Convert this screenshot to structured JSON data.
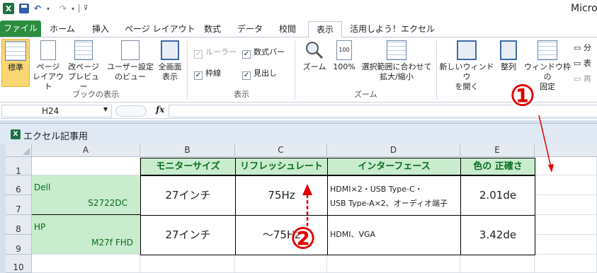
{
  "title_bar": {
    "app_title": "Micro"
  },
  "quick_access": {
    "logo": "X"
  },
  "tabs": [
    {
      "label": "ファイル"
    },
    {
      "label": "ホーム"
    },
    {
      "label": "挿入"
    },
    {
      "label": "ページ レイアウト"
    },
    {
      "label": "数式"
    },
    {
      "label": "データ"
    },
    {
      "label": "校閲"
    },
    {
      "label": "表示"
    },
    {
      "label": "活用しよう！エクセル"
    }
  ],
  "ribbon": {
    "groups": {
      "book_view": "ブックの表示",
      "show": "表示",
      "zoom": "ズーム"
    },
    "book_view": {
      "normal": "標準",
      "page_layout_1": "ページ",
      "page_layout_2": "レイアウト",
      "page_break_1": "改ページ",
      "page_break_2": "プレビュー",
      "custom_1": "ユーザー設定",
      "custom_2": "のビュー",
      "full_1": "全画面",
      "full_2": "表示"
    },
    "show": {
      "ruler": "ルーラー",
      "formula_bar": "数式バー",
      "gridlines": "枠線",
      "headings": "見出し"
    },
    "zoom": {
      "zoom": "ズーム",
      "hundred": "100%",
      "to_selection_1": "選択範囲に合わせて",
      "to_selection_2": "拡大/縮小"
    },
    "window": {
      "new_window_1": "新しいウィンドウ",
      "new_window_2": "を開く",
      "arrange": "整列",
      "freeze_1": "ウィンドウ枠の",
      "freeze_2": "固定",
      "split": "分",
      "hide": "表",
      "unhide": "再"
    }
  },
  "formula_bar": {
    "name_box": "H24",
    "fx": "fx"
  },
  "workbook": {
    "title": "エクセル記事用"
  },
  "sheet": {
    "columns": [
      "A",
      "B",
      "C",
      "D",
      "E"
    ],
    "rows": [
      "1",
      "6",
      "7",
      "8",
      "9",
      "10"
    ],
    "headers": {
      "b": "モニターサイズ",
      "c": "リフレッシュレート",
      "d": "インターフェース",
      "e": "色の 正確さ"
    },
    "dell": {
      "brand": "Dell",
      "model": "S2722DC",
      "size": "27インチ",
      "refresh": "75Hz",
      "iface_1": "HDMI×2・USB Type-C・",
      "iface_2": "USB Type-A×2、オーディオ端子",
      "color": "2.01de"
    },
    "hp": {
      "brand": "HP",
      "model": "M27f FHD",
      "size": "27インチ",
      "refresh": "～75Hz",
      "iface": "HDMI、VGA",
      "color": "3.42de"
    }
  },
  "annotations": {
    "one": "①",
    "two": "②"
  },
  "colors": {
    "annotation": "#e00000",
    "header_green": "#c8eccd",
    "file_tab": "#2a8d3f"
  }
}
